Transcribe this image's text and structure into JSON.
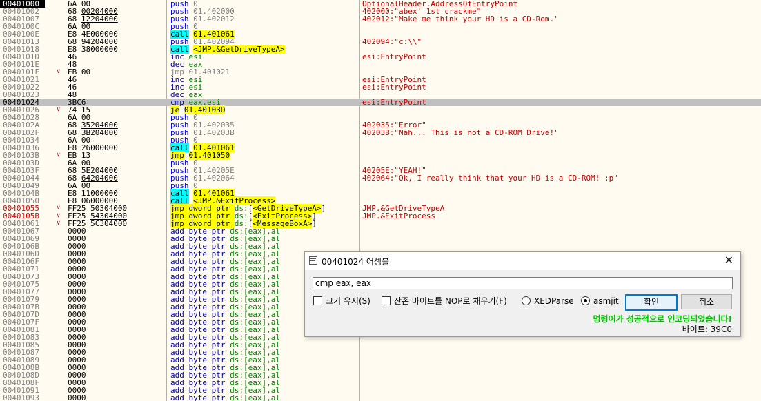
{
  "rows": [
    {
      "addr": "00401000",
      "mark": "cur",
      "arrow": "",
      "bytes": [
        [
          "6A 00",
          false
        ]
      ],
      "ins": [
        [
          "push",
          "mn-push"
        ],
        [
          " 0",
          "op-num"
        ]
      ],
      "cmt": "OptionalHeader.AddressOfEntryPoint"
    },
    {
      "addr": "00401002",
      "arrow": "",
      "bytes": [
        [
          "68 ",
          false
        ],
        [
          "00204000",
          true
        ]
      ],
      "ins": [
        [
          "push",
          "mn-push"
        ],
        [
          " 01.402000",
          "op-num"
        ]
      ],
      "cmt": "402000:\"abex' 1st crackme\""
    },
    {
      "addr": "00401007",
      "arrow": "",
      "bytes": [
        [
          "68 ",
          false
        ],
        [
          "12204000",
          true
        ]
      ],
      "ins": [
        [
          "push",
          "mn-push"
        ],
        [
          " 01.402012",
          "op-num"
        ]
      ],
      "cmt": "402012:\"Make me think your HD is a CD-Rom.\""
    },
    {
      "addr": "0040100C",
      "arrow": "",
      "bytes": [
        [
          "6A 00",
          false
        ]
      ],
      "ins": [
        [
          "push",
          "mn-push"
        ],
        [
          " 0",
          "op-num"
        ]
      ],
      "cmt": ""
    },
    {
      "addr": "0040100E",
      "arrow": "",
      "bytes": [
        [
          "E8 4E000000",
          false
        ]
      ],
      "ins": [
        [
          "call",
          "hl-cyan"
        ],
        [
          " ",
          ""
        ],
        [
          "01.401061",
          "hl-yellow"
        ]
      ],
      "cmt": ""
    },
    {
      "addr": "00401013",
      "arrow": "",
      "bytes": [
        [
          "68 ",
          false
        ],
        [
          "94204000",
          true
        ]
      ],
      "ins": [
        [
          "push",
          "mn-push"
        ],
        [
          " 01.402094",
          "op-num"
        ]
      ],
      "cmt": "402094:\"c:\\\\\""
    },
    {
      "addr": "00401018",
      "arrow": "",
      "bytes": [
        [
          "E8 38000000",
          false
        ]
      ],
      "ins": [
        [
          "call",
          "hl-cyan"
        ],
        [
          " ",
          ""
        ],
        [
          "<JMP.&GetDriveTypeA>",
          "hl-yellow"
        ]
      ],
      "cmt": ""
    },
    {
      "addr": "0040101D",
      "arrow": "",
      "bytes": [
        [
          "46",
          false
        ]
      ],
      "ins": [
        [
          "inc",
          "mn-op"
        ],
        [
          " esi",
          "reg"
        ]
      ],
      "cmt": "esi:EntryPoint"
    },
    {
      "addr": "0040101E",
      "arrow": "",
      "bytes": [
        [
          "48",
          false
        ]
      ],
      "ins": [
        [
          "dec",
          "mn-op"
        ],
        [
          " eax",
          "reg"
        ]
      ],
      "cmt": ""
    },
    {
      "addr": "0040101F",
      "arrow": "v",
      "bytes": [
        [
          "EB 00",
          false
        ]
      ],
      "ins": [
        [
          "jmp",
          "mn-gray"
        ],
        [
          " 01.401021",
          "op-num"
        ]
      ],
      "cmt": ""
    },
    {
      "addr": "00401021",
      "arrow": "",
      "bytes": [
        [
          "46",
          false
        ]
      ],
      "ins": [
        [
          "inc",
          "mn-op"
        ],
        [
          " esi",
          "reg"
        ]
      ],
      "cmt": "esi:EntryPoint"
    },
    {
      "addr": "00401022",
      "arrow": "",
      "bytes": [
        [
          "46",
          false
        ]
      ],
      "ins": [
        [
          "inc",
          "mn-op"
        ],
        [
          " esi",
          "reg"
        ]
      ],
      "cmt": "esi:EntryPoint"
    },
    {
      "addr": "00401023",
      "arrow": "",
      "bytes": [
        [
          "48",
          false
        ]
      ],
      "ins": [
        [
          "dec",
          "mn-op"
        ],
        [
          " eax",
          "reg"
        ]
      ],
      "cmt": ""
    },
    {
      "addr": "00401024",
      "mark": "sel",
      "arrow": "",
      "bytes": [
        [
          "3BC6",
          false
        ]
      ],
      "ins": [
        [
          "cmp",
          "mn-op"
        ],
        [
          " eax,esi",
          "reg"
        ]
      ],
      "cmt": "esi:EntryPoint"
    },
    {
      "addr": "00401026",
      "arrow": "v",
      "bytes": [
        [
          "74 15",
          false
        ]
      ],
      "ins": [
        [
          "je",
          "hl-yellow"
        ],
        [
          " ",
          ""
        ],
        [
          "01.40103D",
          "hl-yellow"
        ]
      ],
      "cmt": ""
    },
    {
      "addr": "00401028",
      "arrow": "",
      "bytes": [
        [
          "6A 00",
          false
        ]
      ],
      "ins": [
        [
          "push",
          "mn-push"
        ],
        [
          " 0",
          "op-num"
        ]
      ],
      "cmt": ""
    },
    {
      "addr": "0040102A",
      "arrow": "",
      "bytes": [
        [
          "68 ",
          false
        ],
        [
          "35204000",
          true
        ]
      ],
      "ins": [
        [
          "push",
          "mn-push"
        ],
        [
          " 01.402035",
          "op-num"
        ]
      ],
      "cmt": "402035:\"Error\""
    },
    {
      "addr": "0040102F",
      "arrow": "",
      "bytes": [
        [
          "68 ",
          false
        ],
        [
          "3B204000",
          true
        ]
      ],
      "ins": [
        [
          "push",
          "mn-push"
        ],
        [
          " 01.40203B",
          "op-num"
        ]
      ],
      "cmt": "40203B:\"Nah... This is not a CD-ROM Drive!\""
    },
    {
      "addr": "00401034",
      "arrow": "",
      "bytes": [
        [
          "6A 00",
          false
        ]
      ],
      "ins": [
        [
          "push",
          "mn-push"
        ],
        [
          " 0",
          "op-num"
        ]
      ],
      "cmt": ""
    },
    {
      "addr": "00401036",
      "arrow": "",
      "bytes": [
        [
          "E8 26000000",
          false
        ]
      ],
      "ins": [
        [
          "call",
          "hl-cyan"
        ],
        [
          " ",
          ""
        ],
        [
          "01.401061",
          "hl-yellow"
        ]
      ],
      "cmt": ""
    },
    {
      "addr": "0040103B",
      "arrow": "v",
      "bytes": [
        [
          "EB 13",
          false
        ]
      ],
      "ins": [
        [
          "jmp",
          "hl-yellow"
        ],
        [
          " ",
          ""
        ],
        [
          "01.401050",
          "hl-yellow"
        ]
      ],
      "cmt": ""
    },
    {
      "addr": "0040103D",
      "arrow": "",
      "bytes": [
        [
          "6A 00",
          false
        ]
      ],
      "ins": [
        [
          "push",
          "mn-push"
        ],
        [
          " 0",
          "op-num"
        ]
      ],
      "cmt": ""
    },
    {
      "addr": "0040103F",
      "arrow": "",
      "bytes": [
        [
          "68 ",
          false
        ],
        [
          "5E204000",
          true
        ]
      ],
      "ins": [
        [
          "push",
          "mn-push"
        ],
        [
          " 01.40205E",
          "op-num"
        ]
      ],
      "cmt": "40205E:\"YEAH!\""
    },
    {
      "addr": "00401044",
      "arrow": "",
      "bytes": [
        [
          "68 ",
          false
        ],
        [
          "64204000",
          true
        ]
      ],
      "ins": [
        [
          "push",
          "mn-push"
        ],
        [
          " 01.402064",
          "op-num"
        ]
      ],
      "cmt": "402064:\"Ok, I really think that your HD is a CD-ROM! :p\""
    },
    {
      "addr": "00401049",
      "arrow": "",
      "bytes": [
        [
          "6A 00",
          false
        ]
      ],
      "ins": [
        [
          "push",
          "mn-push"
        ],
        [
          " 0",
          "op-num"
        ]
      ],
      "cmt": ""
    },
    {
      "addr": "0040104B",
      "arrow": "",
      "bytes": [
        [
          "E8 11000000",
          false
        ]
      ],
      "ins": [
        [
          "call",
          "hl-cyan"
        ],
        [
          " ",
          ""
        ],
        [
          "01.401061",
          "hl-yellow"
        ]
      ],
      "cmt": ""
    },
    {
      "addr": "00401050",
      "arrow": "",
      "bytes": [
        [
          "E8 06000000",
          false
        ]
      ],
      "ins": [
        [
          "call",
          "hl-cyan"
        ],
        [
          " ",
          ""
        ],
        [
          "<JMP.&ExitProcess>",
          "hl-yellow"
        ]
      ],
      "cmt": ""
    },
    {
      "addr": "00401055",
      "mark": "red",
      "arrow": "v",
      "bytes": [
        [
          "FF25 ",
          false
        ],
        [
          "50304000",
          true
        ]
      ],
      "ins": [
        [
          "jmp dword ptr ",
          "hl-yellow"
        ],
        [
          "ds:",
          "kw-g"
        ],
        [
          "[",
          ""
        ],
        [
          "<GetDriveTypeA>",
          "hl-yellow"
        ],
        [
          "]",
          ""
        ]
      ],
      "cmt": "JMP.&GetDriveTypeA"
    },
    {
      "addr": "0040105B",
      "mark": "red",
      "arrow": "v",
      "bytes": [
        [
          "FF25 ",
          false
        ],
        [
          "54304000",
          true
        ]
      ],
      "ins": [
        [
          "jmp dword ptr ",
          "hl-yellow"
        ],
        [
          "ds:",
          "kw-g"
        ],
        [
          "[",
          ""
        ],
        [
          "<ExitProcess>",
          "hl-yellow"
        ],
        [
          "]",
          ""
        ]
      ],
      "cmt": "JMP.&ExitProcess"
    },
    {
      "addr": "00401061",
      "arrow": "v",
      "bytes": [
        [
          "FF25 ",
          false
        ],
        [
          "5C304000",
          true
        ]
      ],
      "ins": [
        [
          "jmp dword ptr ",
          "hl-yellow"
        ],
        [
          "ds:",
          "kw-g"
        ],
        [
          "[",
          ""
        ],
        [
          "<MessageBoxA>",
          "hl-yellow"
        ],
        [
          "]",
          ""
        ]
      ],
      "cmt": ""
    }
  ],
  "filler_addrs": [
    "00401067",
    "00401069",
    "0040106B",
    "0040106D",
    "0040106F",
    "00401071",
    "00401073",
    "00401075",
    "00401077",
    "00401079",
    "0040107B",
    "0040107D",
    "0040107F",
    "00401081",
    "00401083",
    "00401085",
    "00401087",
    "00401089",
    "0040108B",
    "0040108D",
    "0040108F",
    "00401091",
    "00401093"
  ],
  "filler": {
    "bytes": "0000",
    "mn": "add byte ptr ",
    "seg": "ds:",
    "op": "[eax],al"
  },
  "dialog": {
    "title": "00401024 어셈블",
    "close": "✕",
    "input_value": "cmp eax, eax",
    "keep_size": "크기 유지(S)",
    "fill_nop": "잔존 바이트를 NOP로 채우기(F)",
    "xedparse": "XEDParse",
    "asmjit": "asmjit",
    "ok": "확인",
    "cancel": "취소",
    "status": "명령어가 성공적으로 인코딩되었습니다!",
    "bytes_info": "바이트: 39C0"
  }
}
